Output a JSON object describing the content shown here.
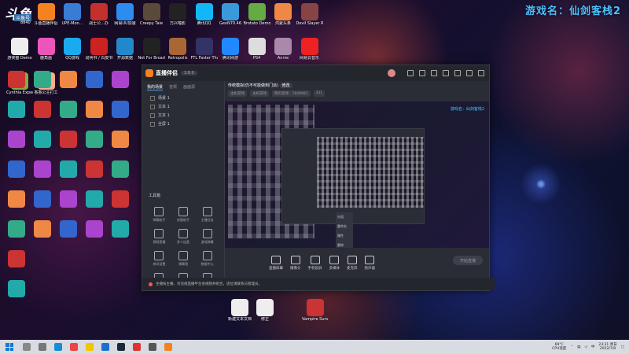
{
  "overlay": {
    "game_name": "游戏名：仙剑客栈2",
    "logo_main": "斗鱼",
    "logo_sub": "斗鱼号",
    "logo_room": "8840"
  },
  "desktop_icons": [
    {
      "label": "",
      "color": "#ccc"
    },
    {
      "label": "斗鱼直播伴侣",
      "color": "#f58220"
    },
    {
      "label": "UPE-Mon...",
      "color": "#3a7bd5"
    },
    {
      "label": "战士公...办",
      "color": "#c4302b"
    },
    {
      "label": "网易UU加速",
      "color": "#2d8cf0"
    },
    {
      "label": "Creepy Tale",
      "color": "#5a4a3a"
    },
    {
      "label": "万兴喵影",
      "color": "#222"
    },
    {
      "label": "腾讯QQ",
      "color": "#12b7f5"
    },
    {
      "label": "GeoN70.46",
      "color": "#3a9ad9"
    },
    {
      "label": "Brotato Demo",
      "color": "#6a4"
    },
    {
      "label": "鸿蒙头条",
      "color": "#e84"
    },
    {
      "label": "Devil Slayer Raksasi",
      "color": "#844"
    },
    {
      "label": "游侠猫 Demo",
      "color": "#eee"
    },
    {
      "label": "鹿角画",
      "color": "#e5b"
    },
    {
      "label": "QQ游戏",
      "color": "#1aaaf0"
    },
    {
      "label": "说明书 / 白皮书",
      "color": "#c22"
    },
    {
      "label": "开源数据",
      "color": "#28c"
    },
    {
      "label": "Not For Broadcast",
      "color": "#222"
    },
    {
      "label": "Retropolis",
      "color": "#a63"
    },
    {
      "label": "FTL Faster Than Light",
      "color": "#336"
    },
    {
      "label": "腾讯网游",
      "color": "#28f"
    },
    {
      "label": "PS4",
      "color": "#ddd"
    },
    {
      "label": "Annie",
      "color": "#a8a"
    },
    {
      "label": "网易云音乐",
      "color": "#e22"
    },
    {
      "label": "Cynthia Expedition",
      "color": "#8a4"
    },
    {
      "label": "香香公主打工",
      "color": "#fa8"
    }
  ],
  "app": {
    "name": "直播伴侣",
    "version": "3.8.0",
    "sidebar_tabs": [
      "我的场景",
      "音频",
      "画面源"
    ],
    "scenes": [
      "场景 1",
      "文本 1",
      "文本 1",
      "全屏 1"
    ],
    "tools_title": "工具箱",
    "tools": [
      "弹幕助手",
      "房管助手",
      "主播任务",
      "视频直播",
      "多人连麦",
      "游戏弹幕",
      "房间设置",
      "弹幕墙",
      "数据中心",
      "小程序",
      "分享",
      "更多"
    ],
    "stream_title": "传统模拟(仍不可能做到门派)",
    "stream_tag": "修改",
    "stream_sub": [
      "主机游戏",
      "主机游戏",
      "网页游戏：7849981",
      "331"
    ],
    "preview_game_name": "游戏名：仙剑客栈2",
    "context_menu": [
      "分组",
      "重命名",
      "属性",
      "删除"
    ],
    "bottom_tools": [
      "直播屏幕",
      "摄像头",
      "手机投屏",
      "多媒体",
      "麦克风",
      "扬声器"
    ],
    "start_label": "开始直播",
    "notice": "主播技主播，对违规直播平台会视频并组合，适位请联系与管理员。"
  },
  "desktop_bottom": [
    {
      "label": "新建文本文档",
      "color": "#eee"
    },
    {
      "label": "修正",
      "color": "#eee"
    },
    {
      "label": "Vampire Survivors",
      "color": "#c33"
    }
  ],
  "taskbar": {
    "pinned": [
      {
        "name": "search",
        "color": "#888"
      },
      {
        "name": "task-view",
        "color": "#777"
      },
      {
        "name": "edge",
        "color": "#1a8bd6"
      },
      {
        "name": "chrome",
        "color": "#e44"
      },
      {
        "name": "file-explorer",
        "color": "#f4c400"
      },
      {
        "name": "store",
        "color": "#1b6fd1"
      },
      {
        "name": "steam",
        "color": "#1b2838"
      },
      {
        "name": "netease",
        "color": "#d33"
      },
      {
        "name": "app",
        "color": "#555"
      },
      {
        "name": "douyu",
        "color": "#f58220"
      }
    ],
    "weather": "69°C",
    "weather_sub": "CPU温度",
    "time": "23:21 周日",
    "date": "2022/7/8",
    "ime": "中"
  }
}
